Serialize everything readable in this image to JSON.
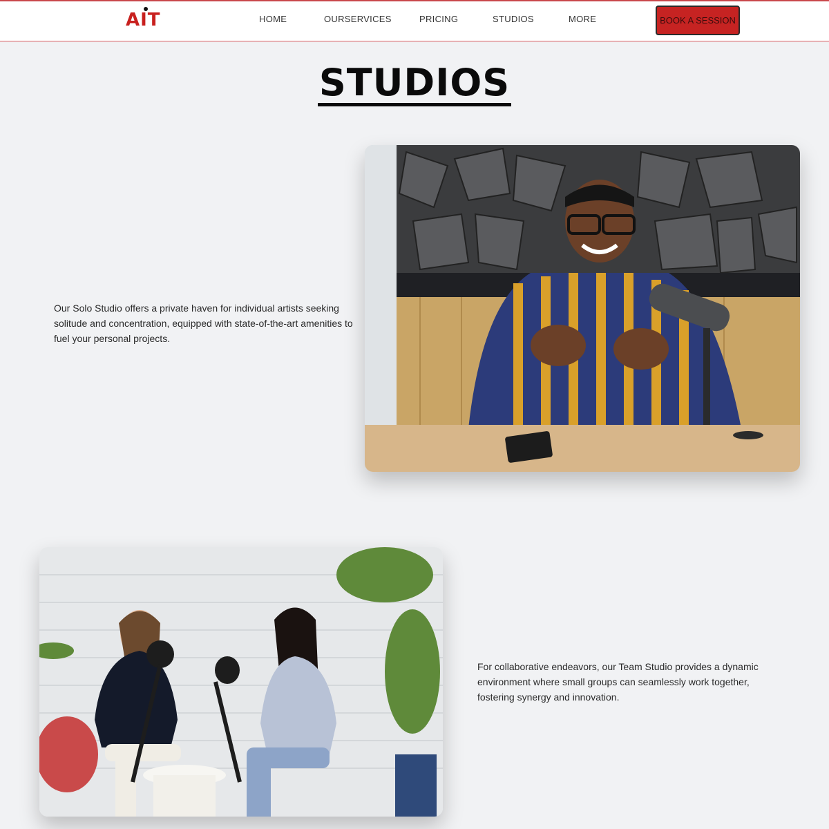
{
  "brand": {
    "logo_text": "AIT",
    "accent": "#c8201e"
  },
  "nav": {
    "items": [
      {
        "label": "HOME"
      },
      {
        "label": "OURSERVICES"
      },
      {
        "label": "PRICING"
      },
      {
        "label": "STUDIOS"
      },
      {
        "label": "MORE"
      }
    ],
    "cta_label": "BOOK A SESSION"
  },
  "page": {
    "title": "STUDIOS"
  },
  "sections": [
    {
      "text": "Our Solo Studio offers a private haven for individual artists seeking solitude and concentration, equipped with state-of-the-art amenities to fuel your personal projects.",
      "image": "solo-studio-podcaster-photo"
    },
    {
      "text": "For collaborative endeavors, our Team Studio provides a dynamic environment where small groups can seamlessly work together, fostering synergy and innovation.",
      "image": "team-studio-podcast-photo"
    }
  ]
}
